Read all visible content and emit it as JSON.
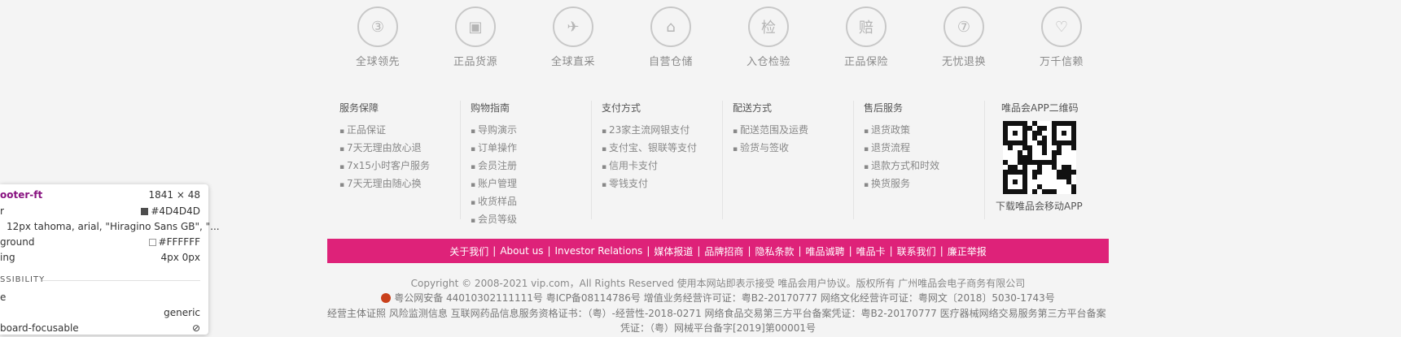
{
  "services": [
    {
      "label": "全球领先",
      "icon": "medal-3-icon",
      "glyph": "③"
    },
    {
      "label": "正品货源",
      "icon": "box-icon",
      "glyph": "▣"
    },
    {
      "label": "全球直采",
      "icon": "plane-icon",
      "glyph": "✈"
    },
    {
      "label": "自营仓储",
      "icon": "warehouse-icon",
      "glyph": "⌂"
    },
    {
      "label": "入仓检验",
      "icon": "inspect-icon",
      "glyph": "检"
    },
    {
      "label": "正品保险",
      "icon": "shield-icon",
      "glyph": "赔"
    },
    {
      "label": "无忧退换",
      "icon": "return-7-icon",
      "glyph": "⑦"
    },
    {
      "label": "万千信赖",
      "icon": "heart-icon",
      "glyph": "♡"
    }
  ],
  "columns": [
    {
      "title": "服务保障",
      "links": [
        "正品保证",
        "7天无理由放心退",
        "7x15小时客户服务",
        "7天无理由随心换"
      ]
    },
    {
      "title": "购物指南",
      "links": [
        "导购演示",
        "订单操作",
        "会员注册",
        "账户管理",
        "收货样品",
        "会员等级"
      ]
    },
    {
      "title": "支付方式",
      "links": [
        "23家主流网银支付",
        "支付宝、银联等支付",
        "信用卡支付",
        "零钱支付"
      ]
    },
    {
      "title": "配送方式",
      "links": [
        "配送范围及运费",
        "验货与签收"
      ]
    },
    {
      "title": "售后服务",
      "links": [
        "退货政策",
        "退货流程",
        "退款方式和时效",
        "换货服务"
      ]
    }
  ],
  "qr": {
    "title": "唯品会APP二维码",
    "caption": "下载唯品会移动APP"
  },
  "bar_links": [
    "关于我们",
    "About us",
    "Investor Relations",
    "媒体报道",
    "品牌招商",
    "隐私条款",
    "唯品诚聘",
    "唯品卡",
    "联系我们",
    "廉正举报"
  ],
  "copyright": {
    "line1": "Copyright © 2008-2021 vip.com，All Rights Reserved  使用本网站即表示接受  唯品会用户协议。版权所有 广州唯品会电子商务有限公司",
    "line2": "粤公网安备 44010302111111号    粤ICP备08114786号  增值业务经营许可证：粤B2-20170777  网络文化经营许可证：粤网文〔2018〕5030-1743号",
    "line3": "经营主体证照   风险监测信息   互联网药品信息服务资格证书：（粤）-经营性-2018-0271  网络食品交易第三方平台备案凭证：粤B2-20170777  医疗器械网络交易服务第三方平台备案",
    "line4": "凭证：（粤）网械平台备字[2019]第00001号"
  },
  "tooltip": {
    "selector": "ooter-ft",
    "size": "1841 × 48",
    "color_label": "r",
    "color_value": "#4D4D4D",
    "font_value": "12px tahoma, arial, \"Hiragino Sans GB\", \"...",
    "bg_label": "ground",
    "bg_value": "#FFFFFF",
    "padding_label": "ing",
    "padding_value": "4px 0px",
    "section": "SSIBILITY",
    "role_label": "e",
    "role_value": "generic",
    "focus_label": "board-focusable",
    "swatch_dark": "#4D4D4D",
    "swatch_light": "#FFFFFF"
  }
}
